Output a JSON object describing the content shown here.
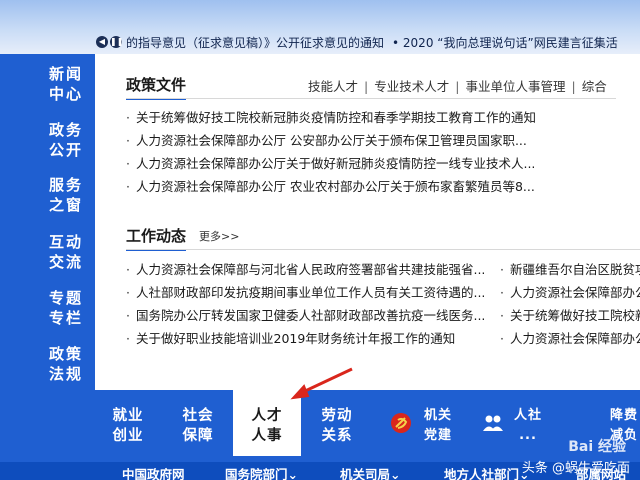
{
  "ticker": {
    "items": [
      "的指导意见（征求意见稿）》公开征求意见的通知",
      "• 2020 “我向总理说句话”网民建言征集活"
    ]
  },
  "leftnav": [
    {
      "line1": "新闻",
      "line2": "中心"
    },
    {
      "line1": "政务",
      "line2": "公开"
    },
    {
      "line1": "服务",
      "line2": "之窗"
    },
    {
      "line1": "互动",
      "line2": "交流"
    },
    {
      "line1": "专题",
      "line2": "专栏"
    },
    {
      "line1": "政策",
      "line2": "法规"
    }
  ],
  "policy": {
    "title": "政策文件",
    "tabs": [
      "技能人才",
      "专业技术人才",
      "事业单位人事管理",
      "综合"
    ],
    "items": [
      "关于统筹做好技工院校新冠肺炎疫情防控和春季学期技工教育工作的通知",
      "人力资源社会保障部办公厅 公安部办公厅关于颁布保卫管理员国家职...",
      "人力资源社会保障部办公厅关于做好新冠肺炎疫情防控一线专业技术人...",
      "人力资源社会保障部办公厅 农业农村部办公厅关于颁布家畜繁殖员等8..."
    ]
  },
  "work": {
    "title": "工作动态",
    "more": "更多>>",
    "col1": [
      "人力资源社会保障部与河北省人民政府签署部省共建技能强省...",
      "人社部财政部印发抗疫期间事业单位工作人员有关工资待遇的...",
      "国务院办公厅转发国家卫健委人社部财政部改善抗疫一线医务...",
      "关于做好职业技能培训业2019年财务统计年报工作的通知"
    ],
    "col2": [
      "新疆维吾尔自治区脱贫攻坚",
      "人力资源社会保障部办公厅",
      "关于统筹做好技工院校新冠",
      "人力资源社会保障部办公厅"
    ]
  },
  "bottom": {
    "tabs": [
      {
        "line1": "就业",
        "line2": "创业"
      },
      {
        "line1": "社会",
        "line2": "保障"
      },
      {
        "line1": "人才",
        "line2": "人事"
      },
      {
        "line1": "劳动",
        "line2": "关系"
      }
    ],
    "party": {
      "line1": "机关",
      "line2": "党建"
    },
    "social": {
      "line1": "人社",
      "line2": "..."
    },
    "reduce": {
      "line1": "降费",
      "line2": "减负"
    },
    "strip": [
      "中国政府网",
      "国务院部门⌄",
      "机关司局⌄",
      "地方人社部门⌄",
      "部属网站"
    ]
  },
  "watermark": {
    "brand": "Bai 经验",
    "credit": "头条 @蜗牛爱吃面"
  },
  "colors": {
    "primary": "#1f5fd1",
    "arrow": "#d9261c"
  }
}
